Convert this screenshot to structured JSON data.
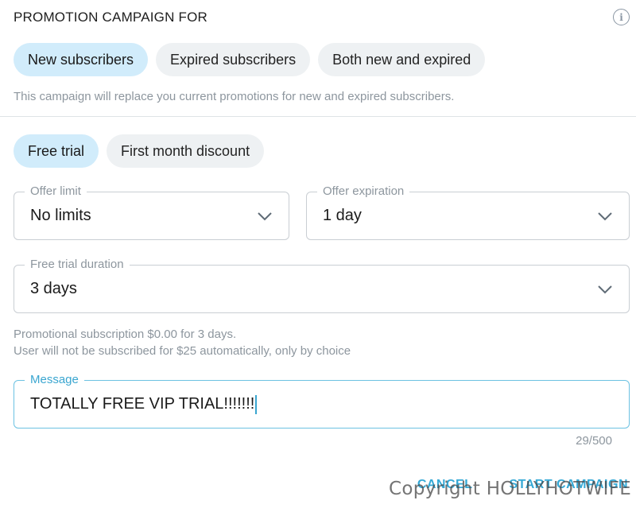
{
  "header": {
    "title": "PROMOTION CAMPAIGN FOR",
    "info_icon": "info-icon"
  },
  "audience": {
    "options": [
      "New subscribers",
      "Expired subscribers",
      "Both new and expired"
    ],
    "selected": "New subscribers",
    "note": "This campaign will replace you current promotions for new and expired subscribers."
  },
  "offer_type": {
    "options": [
      "Free trial",
      "First month discount"
    ],
    "selected": "Free trial"
  },
  "offer_limit": {
    "label": "Offer limit",
    "value": "No limits"
  },
  "offer_expiration": {
    "label": "Offer expiration",
    "value": "1 day"
  },
  "trial_duration": {
    "label": "Free trial duration",
    "value": "3 days"
  },
  "summary": {
    "line1": "Promotional subscription $0.00 for 3 days.",
    "line2": "User will not be subscribed for $25 automatically, only by choice"
  },
  "message": {
    "label": "Message",
    "value": "TOTALLY FREE VIP TRIAL!!!!!!!",
    "counter": "29/500"
  },
  "actions": {
    "cancel": "CANCEL",
    "start": "START CAMPAIGN"
  },
  "watermark": "Copyright HOLLYHOTWIFE",
  "colors": {
    "accent": "#35a9d6",
    "active_pill": "#d1ecfb",
    "pill": "#eef1f3",
    "muted_text": "#8d969e"
  }
}
